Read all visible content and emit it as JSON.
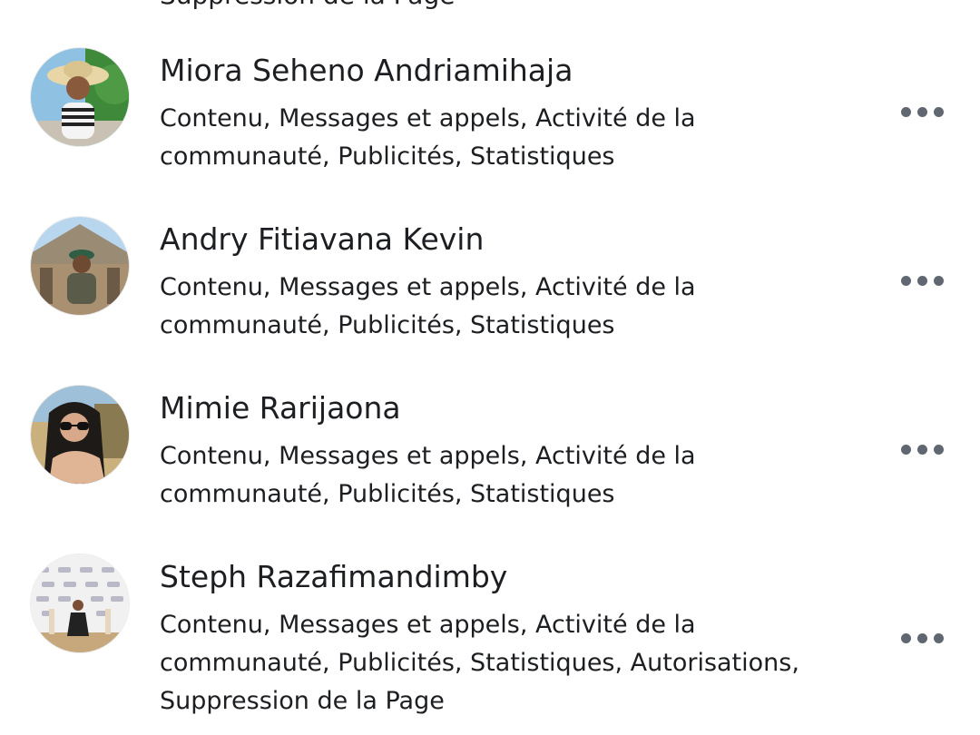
{
  "cut_off_top_text": "Suppression de la Page",
  "admins": [
    {
      "name": "Miora Seheno Andriamihaja",
      "permissions": "Contenu, Messages et appels, Activité de la communauté, Publicités, Statistiques",
      "avatar_icon": "person-photo-icon",
      "more_icon": "more-options-icon"
    },
    {
      "name": "Andry Fitiavana Kevin",
      "permissions": "Contenu, Messages et appels, Activité de la communauté, Publicités, Statistiques",
      "avatar_icon": "person-photo-icon",
      "more_icon": "more-options-icon"
    },
    {
      "name": "Mimie Rarijaona",
      "permissions": "Contenu, Messages et appels, Activité de la communauté, Publicités, Statistiques",
      "avatar_icon": "person-photo-icon",
      "more_icon": "more-options-icon"
    },
    {
      "name": "Steph Razafimandimby",
      "permissions": "Contenu, Messages et appels, Activité de la communauté, Publicités, Statistiques, Autorisations, Suppression de la Page",
      "avatar_icon": "person-photo-icon",
      "more_icon": "more-options-icon"
    }
  ],
  "colors": {
    "text": "#1c1e21",
    "icon": "#606770",
    "background": "#ffffff"
  }
}
